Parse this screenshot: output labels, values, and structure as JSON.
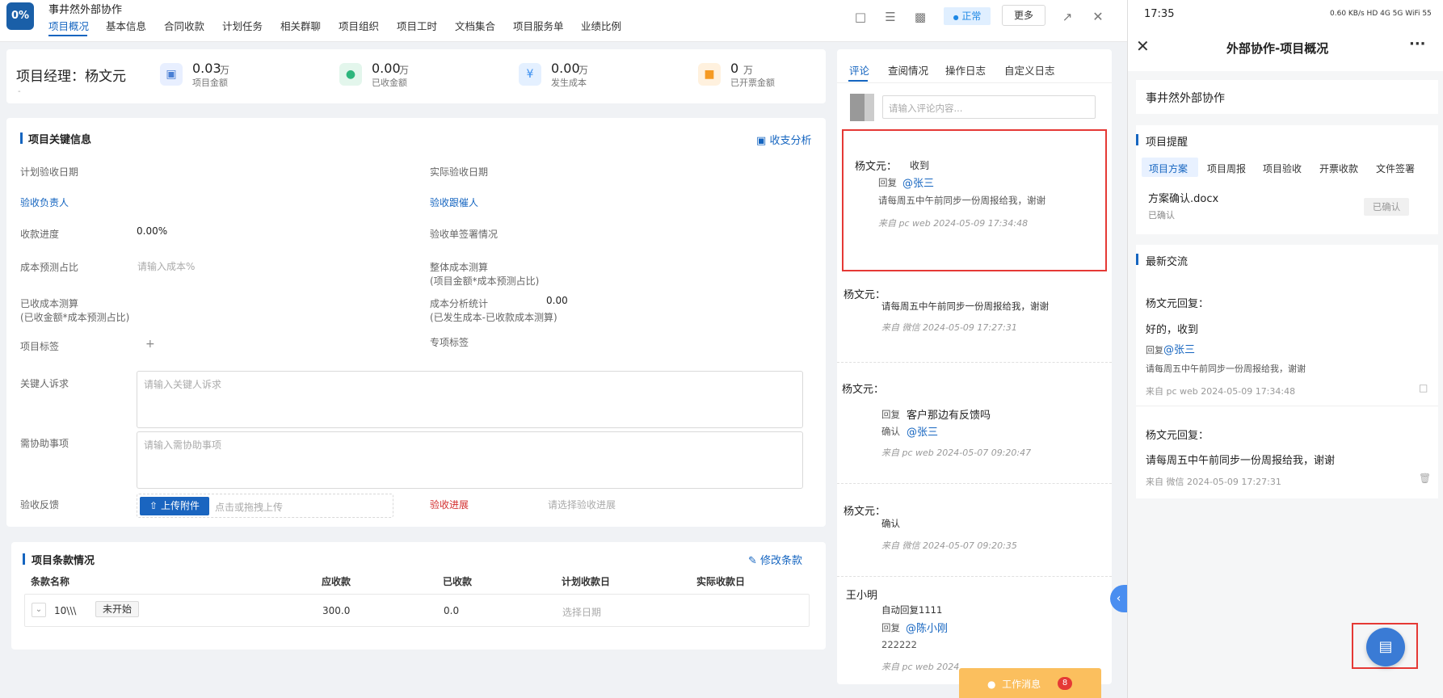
{
  "app": {
    "logo_text": "0%",
    "project_title": "事井然外部协作",
    "nav_tabs": [
      "项目概况",
      "基本信息",
      "合同收款",
      "计划任务",
      "相关群聊",
      "项目组织",
      "项目工时",
      "文档集合",
      "项目服务单",
      "业绩比例"
    ],
    "status": "正常",
    "more": "更多"
  },
  "summary": {
    "manager": "项目经理：杨文元",
    "dash": "-",
    "stats": [
      {
        "value": "0.03",
        "unit": "万",
        "label": "项目金额",
        "icon": "wallet-icon",
        "color": "#4a7fd4"
      },
      {
        "value": "0.00",
        "unit": "万",
        "label": "已收金额",
        "icon": "hand-money-icon",
        "color": "#2eb67d"
      },
      {
        "value": "0.00",
        "unit": "万",
        "label": "发生成本",
        "icon": "cost-icon",
        "color": "#3b8ff0"
      },
      {
        "value": "0",
        "unit": "万",
        "label": "已开票金额",
        "icon": "invoice-icon",
        "color": "#f59a23"
      }
    ]
  },
  "key_info": {
    "title": "项目关键信息",
    "analysis_link": "收支分析",
    "planned_acceptance": "计划验收日期",
    "actual_acceptance": "实际验收日期",
    "acceptance_owner": "验收负责人",
    "acceptance_follower": "验收跟催人",
    "payment_progress": "收款进度",
    "payment_progress_value": "0.00%",
    "signing_status": "验收单签署情况",
    "cost_ratio": "成本预测占比",
    "cost_ratio_ph": "请输入成本%",
    "overall_cost": "整体成本测算",
    "overall_cost_formula": "(项目金额*成本预测占比)",
    "received_cost": "已收成本测算",
    "received_cost_formula": "(已收金额*成本预测占比)",
    "cost_analysis": "成本分析统计",
    "cost_analysis_value": "0.00",
    "cost_analysis_formula": "(已发生成本-已收款成本测算)",
    "tags": "项目标签",
    "tags_add": "+",
    "special_sign": "专项标签",
    "key_demand": "关键人诉求",
    "key_demand_ph": "请输入关键人诉求",
    "assist": "需协助事项",
    "assist_ph": "请输入需协助事项",
    "feedback": "验收反馈",
    "upload_btn": "上传附件",
    "upload_ph": "点击或拖拽上传",
    "progress": "验收进展",
    "progress_ph": "请选择验收进展"
  },
  "terms": {
    "title": "项目条款情况",
    "edit_link": "修改条款",
    "columns": [
      "条款名称",
      "应收款",
      "已收款",
      "计划收款日",
      "实际收款日"
    ],
    "rows": [
      {
        "name": "10\\\\\\",
        "status": "未开始",
        "receivable": "300.0",
        "received": "0.0",
        "plan_date_ph": "选择日期"
      }
    ]
  },
  "comments": {
    "tabs": [
      "评论",
      "查阅情况",
      "操作日志",
      "自定义日志"
    ],
    "input_ph": "请输入评论内容...",
    "reply_label": "回复",
    "confirm_label": "确认",
    "items": [
      {
        "name": "杨文元：",
        "head_text": "收到",
        "mention": "@张三",
        "body": "请每周五中午前同步一份周报给我，谢谢",
        "meta": "来自 pc web 2024-05-09 17:34:48"
      },
      {
        "name": "杨文元：",
        "body": "请每周五中午前同步一份周报给我，谢谢",
        "meta": "来自 微信 2024-05-09 17:27:31"
      },
      {
        "name": "杨文元：",
        "reply_text": "客户那边有反馈吗",
        "mention": "@张三",
        "meta": "来自 pc web 2024-05-07 09:20:47"
      },
      {
        "name": "杨文元：",
        "body": "确认",
        "meta": "来自 微信 2024-05-07 09:20:35"
      },
      {
        "name": "王小明",
        "body": "自动回复1111",
        "mention": "@陈小刚",
        "body2": "222222",
        "meta": "来自 pc web 2024"
      }
    ],
    "work_msg": "工作消息",
    "work_msg_count": "8"
  },
  "mobile": {
    "time": "17:35",
    "status_icons": "0.60 KB/s  HD  4G  5G  WiFi  55",
    "title": "外部协作-项目概况",
    "more": "···",
    "project": "事井然外部协作",
    "reminder_title": "项目提醒",
    "reminder_tabs": [
      "项目方案",
      "项目周报",
      "项目验收",
      "开票收款",
      "文件签署"
    ],
    "file_name": "方案确认.docx",
    "file_status": "已确认",
    "file_btn": "已确认",
    "latest_title": "最新交流",
    "msgs": [
      {
        "who": "杨文元回复：",
        "text": "好的，收到",
        "reply_label": "回复",
        "mention": "@张三",
        "quote": "请每周五中午前同步一份周报给我，谢谢",
        "meta": "来自 pc web 2024-05-09 17:34:48"
      },
      {
        "who": "杨文元回复：",
        "text": "请每周五中午前同步一份周报给我，谢谢",
        "meta": "来自 微信 2024-05-09 17:27:31"
      }
    ]
  }
}
